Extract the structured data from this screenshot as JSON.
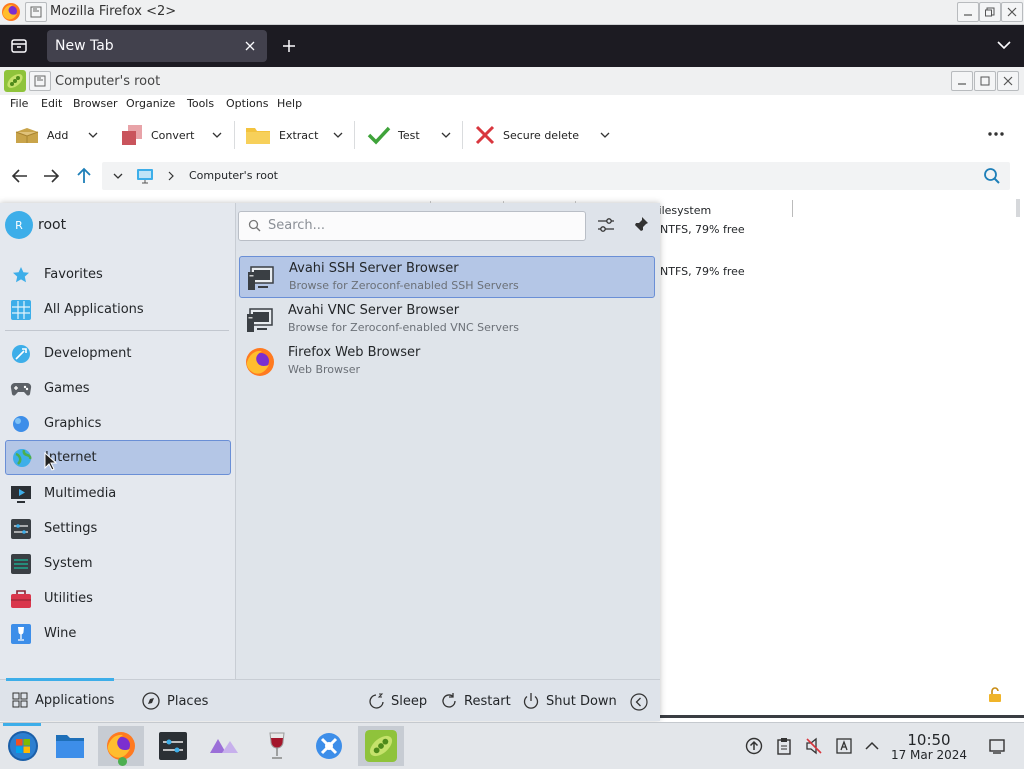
{
  "firefox": {
    "window_title": "Mozilla Firefox <2>",
    "tab_title": "New Tab"
  },
  "peazip": {
    "window_title": "Computer's root",
    "menu": [
      "File",
      "Edit",
      "Browser",
      "Organize",
      "Tools",
      "Options",
      "Help"
    ],
    "toolbar": {
      "add": "Add",
      "convert": "Convert",
      "extract": "Extract",
      "test": "Test",
      "secure_delete": "Secure delete"
    },
    "path": "Computer's root",
    "list": {
      "column_filesystem": "Filesystem",
      "rows": [
        "NTFS, 79% free",
        "NTFS, 79% free"
      ]
    }
  },
  "launcher": {
    "user": "root",
    "user_initial": "R",
    "search_placeholder": "Search...",
    "categories": [
      {
        "label": "Favorites",
        "icon": "star-icon"
      },
      {
        "label": "All Applications",
        "icon": "grid-icon"
      },
      {
        "label": "Development",
        "icon": "development-icon"
      },
      {
        "label": "Games",
        "icon": "gamepad-icon"
      },
      {
        "label": "Graphics",
        "icon": "graphics-icon"
      },
      {
        "label": "Internet",
        "icon": "globe-icon"
      },
      {
        "label": "Multimedia",
        "icon": "multimedia-icon"
      },
      {
        "label": "Settings",
        "icon": "settings-icon"
      },
      {
        "label": "System",
        "icon": "system-icon"
      },
      {
        "label": "Utilities",
        "icon": "toolbox-icon"
      },
      {
        "label": "Wine",
        "icon": "wine-icon"
      }
    ],
    "selected_category": "Internet",
    "apps": [
      {
        "name": "Avahi SSH Server Browser",
        "desc": "Browse for Zeroconf-enabled SSH Servers",
        "icon": "network-monitor-icon"
      },
      {
        "name": "Avahi VNC Server Browser",
        "desc": "Browse for Zeroconf-enabled VNC Servers",
        "icon": "network-monitor-icon"
      },
      {
        "name": "Firefox Web Browser",
        "desc": "Web Browser",
        "icon": "firefox-icon"
      }
    ],
    "footer": {
      "applications": "Applications",
      "places": "Places",
      "sleep": "Sleep",
      "restart": "Restart",
      "shutdown": "Shut Down"
    }
  },
  "taskbar": {
    "time": "10:50",
    "date": "17 Mar 2024"
  },
  "colors": {
    "selection": "#b4c6e6",
    "selection_border": "#6a8fd6",
    "firefox_tabstrip": "#1c1b22",
    "accent": "#3daee9"
  }
}
